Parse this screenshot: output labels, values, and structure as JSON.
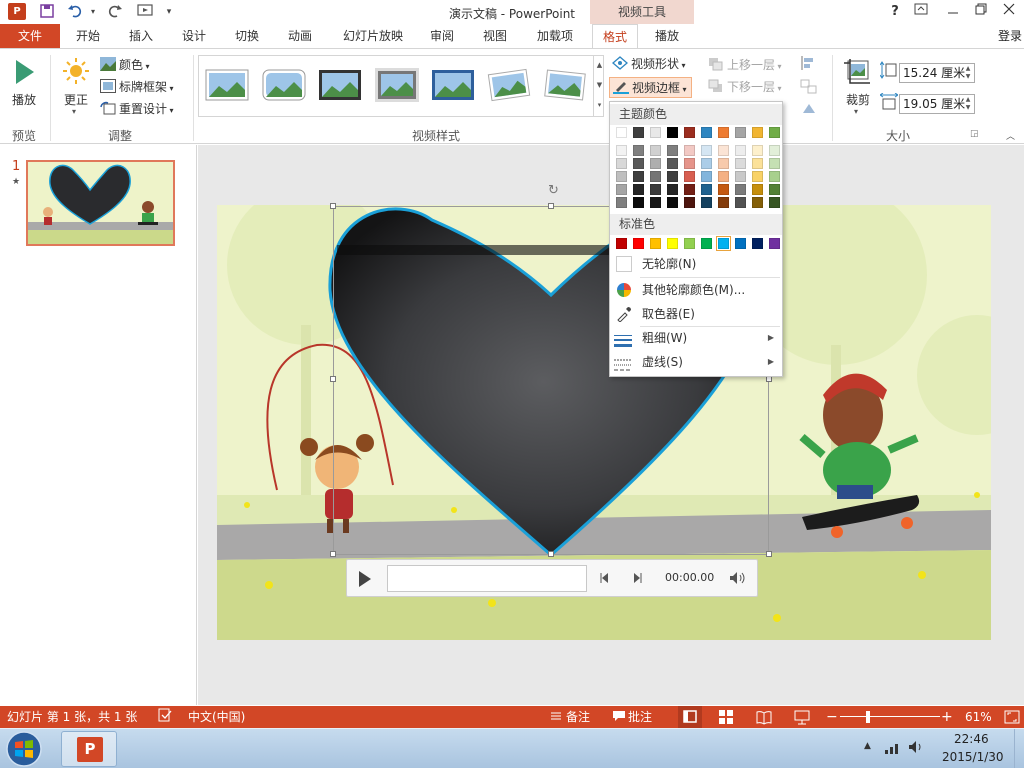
{
  "titlebar": {
    "title": "演示文稿 - PowerPoint",
    "context_tab_group": "视频工具",
    "help": "?",
    "app_logo": "P"
  },
  "tabs": [
    "文件",
    "开始",
    "插入",
    "设计",
    "切换",
    "动画",
    "幻灯片放映",
    "审阅",
    "视图",
    "加载项",
    "格式",
    "播放"
  ],
  "active_tab": "格式",
  "login_label": "登录",
  "ribbon": {
    "preview": {
      "play_label": "播放",
      "group": "预览"
    },
    "adjust": {
      "group": "调整",
      "corrections_label": "更正",
      "color_label": "颜色",
      "poster_frame_label": "标牌框架",
      "reset_design_label": "重置设计"
    },
    "video_styles": {
      "group": "视频样式",
      "shape_label": "视频形状",
      "border_label": "视频边框"
    },
    "arrange": {
      "bring_forward_label": "上移一层",
      "send_backward_label": "下移一层"
    },
    "size": {
      "group": "大小",
      "crop_label": "裁剪",
      "height_value": "15.24 厘米",
      "width_value": "19.05 厘米"
    }
  },
  "slides_pane": {
    "slide_number": "1",
    "star": "★"
  },
  "media_controls": {
    "time": "00:00.00"
  },
  "dropdown": {
    "theme_colors_header": "主题颜色",
    "standard_colors_header": "标准色",
    "theme_top_row": [
      "#ffffff",
      "#3f3f3f",
      "#e8e8e8",
      "#000000",
      "#9b2d1f",
      "#2e86c1",
      "#ee7b31",
      "#a5a5a5",
      "#f1b532",
      "#70ad47"
    ],
    "theme_shades": [
      [
        "#f2f2f2",
        "#d8d8d8",
        "#bfbfbf",
        "#a5a5a5",
        "#7f7f7f"
      ],
      [
        "#808080",
        "#595959",
        "#3f3f3f",
        "#262626",
        "#0c0c0c"
      ],
      [
        "#d0d0d0",
        "#aeaeae",
        "#757575",
        "#3a3a3a",
        "#171717"
      ],
      [
        "#7f7f7f",
        "#595959",
        "#3f3f3f",
        "#262626",
        "#0c0c0c"
      ],
      [
        "#f2c9c4",
        "#e5948a",
        "#d85e50",
        "#731f15",
        "#4d150e"
      ],
      [
        "#d5e6f3",
        "#abcde8",
        "#82b5dc",
        "#1f628f",
        "#14415f"
      ],
      [
        "#fbe4d5",
        "#f7caac",
        "#f4b083",
        "#c45911",
        "#843c0b"
      ],
      [
        "#ededed",
        "#dbdbdb",
        "#c9c9c9",
        "#7b7b7b",
        "#525252"
      ],
      [
        "#fdf0cc",
        "#fbe199",
        "#f9d266",
        "#c68f0c",
        "#845f08"
      ],
      [
        "#e2efd9",
        "#c5e0b3",
        "#a8d08d",
        "#538135",
        "#375623"
      ]
    ],
    "standard_colors": [
      "#c00000",
      "#ff0000",
      "#ffc000",
      "#ffff00",
      "#92d050",
      "#00b050",
      "#00b0f0",
      "#0070c0",
      "#002060",
      "#7030a0"
    ],
    "selected_standard_index": 6,
    "no_outline": "无轮廓(N)",
    "more_colors": "其他轮廓颜色(M)...",
    "eyedropper": "取色器(E)",
    "weight": "粗细(W)",
    "dashes": "虚线(S)"
  },
  "status": {
    "slide_info": "幻灯片 第 1 张，共 1 张",
    "language": "中文(中国)",
    "notes_label": "备注",
    "comments_label": "批注",
    "zoom_label": "61%"
  },
  "taskbar": {
    "time": "22:46",
    "date": "2015/1/30"
  },
  "colors": {
    "accent": "#d24726",
    "video_border": "#1aa0d8"
  }
}
